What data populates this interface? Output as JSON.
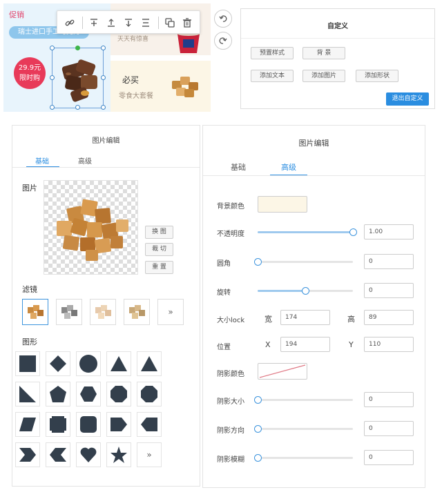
{
  "banner": {
    "promo_tag": "促销",
    "promo_title": "瑞士进口手工巧克力",
    "price": "29.9元",
    "price_note": "限时购",
    "dessert_sub": "天天有惊喜",
    "snack_title": "必买",
    "snack_sub": "零食大套餐"
  },
  "float_toolbar": {
    "icons": [
      "link-icon",
      "align-top-icon",
      "align-middle-icon",
      "align-bottom-icon",
      "align-center-icon",
      "copy-icon",
      "delete-icon"
    ]
  },
  "history": {
    "undo_icon": "undo-icon",
    "redo_icon": "redo-icon"
  },
  "custom_panel": {
    "title": "自定义",
    "buttons": [
      "预置样式",
      "背 景",
      "添加文本",
      "添加图片",
      "添加形状"
    ],
    "exit_label": "退出自定义",
    "accent": "#2a8de0"
  },
  "image_edit": {
    "title": "图片编辑",
    "tabs": [
      "基础",
      "高级"
    ],
    "active_tab": "基础",
    "image_label": "图片",
    "image_buttons": [
      "换 图",
      "裁 切",
      "重 置"
    ],
    "filter_label": "滤镜",
    "filter_more": "»",
    "shape_label": "图形",
    "shapes": [
      "square",
      "diamond",
      "circle",
      "triangle",
      "triangle-b",
      "right-triangle",
      "pentagon",
      "hexagon",
      "octagon-l",
      "octagon",
      "parallelogram",
      "notched-square",
      "rounded-square",
      "tag-right",
      "tag-left",
      "chevron-right",
      "chevron-left",
      "heart",
      "star",
      "more"
    ],
    "shape_more": "»"
  },
  "advanced": {
    "title": "图片编辑",
    "tabs": [
      "基础",
      "高级"
    ],
    "active_tab": "高级",
    "bg_color_label": "背景颜色",
    "bg_color": "#fcf6e6",
    "opacity_label": "不透明度",
    "opacity": "1.00",
    "opacity_pct": 100,
    "radius_label": "圆角",
    "radius": "0",
    "radius_pct": 0,
    "rotate_label": "旋转",
    "rotate": "0",
    "rotate_pct": 50,
    "size_label": "大小lock",
    "width_label": "宽",
    "width": "174",
    "height_label": "高",
    "height": "89",
    "pos_label": "位置",
    "x_label": "X",
    "x": "194",
    "y_label": "Y",
    "y": "110",
    "shadow_color_label": "阴影颜色",
    "shadow_size_label": "阴影大小",
    "shadow_size": "0",
    "shadow_dir_label": "阴影方向",
    "shadow_dir": "0",
    "shadow_blur_label": "阴影模糊",
    "shadow_blur": "0"
  }
}
